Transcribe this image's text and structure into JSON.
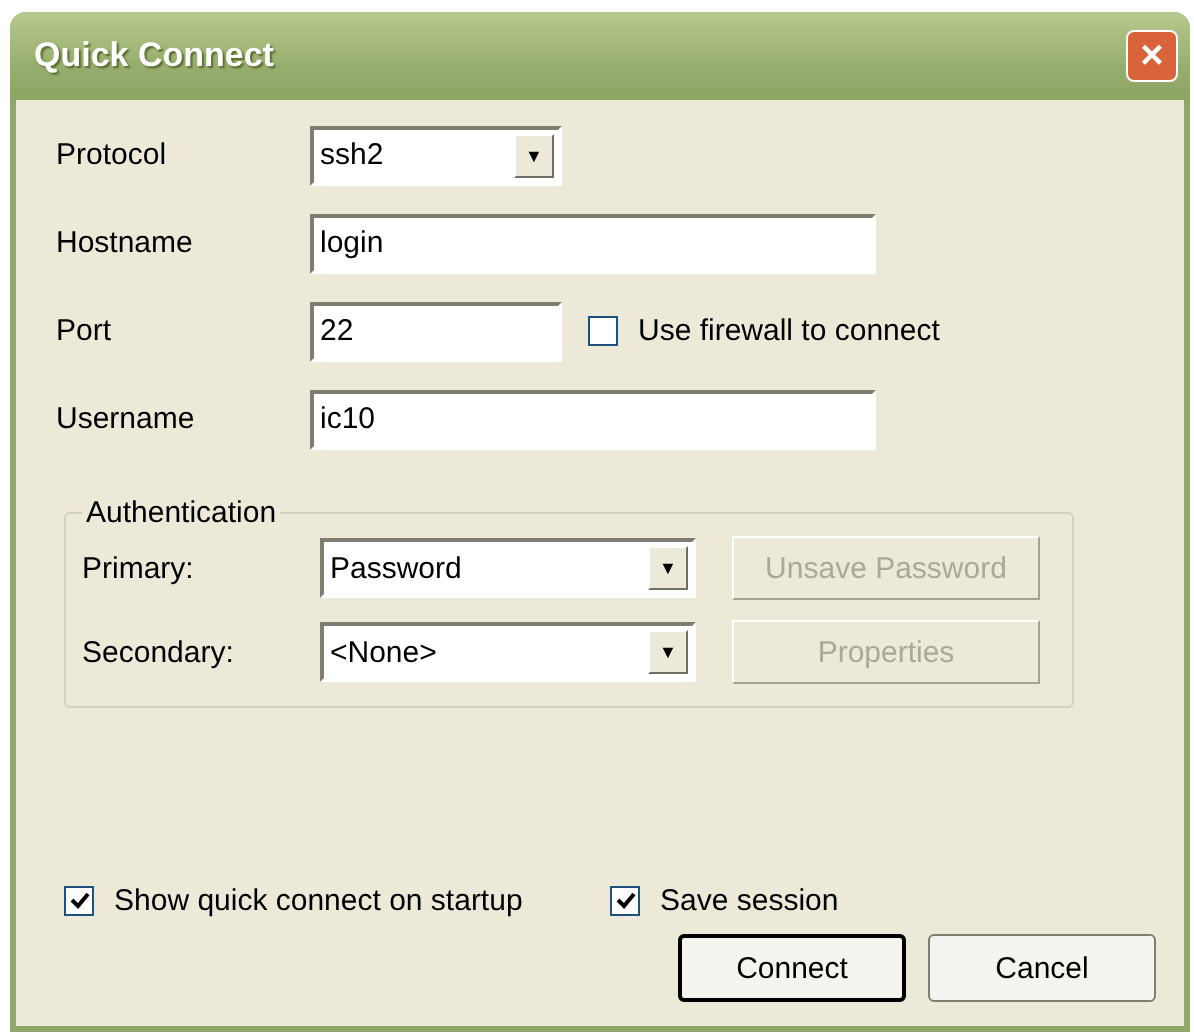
{
  "window": {
    "title": "Quick Connect",
    "close": "×"
  },
  "fields": [
    {
      "kind": "select",
      "label": "Protocol",
      "value": "ssh2",
      "arrow": "▼"
    },
    {
      "kind": "input",
      "label": "Hostname",
      "value": "login"
    },
    {
      "kind": "input",
      "label": "Port",
      "value": "22",
      "checkbox": {
        "label": "Use firewall to connect",
        "checked": false
      }
    },
    {
      "kind": "input",
      "label": "Username",
      "value": "ic10"
    }
  ],
  "authentication": {
    "title": "Authentication",
    "rows": [
      {
        "label": "Primary:",
        "value": "Password",
        "arrow": "▼",
        "button": {
          "label": "Unsave Password",
          "disabled": true
        }
      },
      {
        "label": "Secondary:",
        "value": "<None>",
        "arrow": "▼",
        "button": {
          "label": "Properties",
          "disabled": true
        }
      }
    ]
  },
  "options": [
    {
      "label": "Show quick connect on startup",
      "checked": true
    },
    {
      "label": "Save session",
      "checked": true
    }
  ],
  "buttons": [
    {
      "label": "Connect",
      "default": true
    },
    {
      "label": "Cancel",
      "default": false
    }
  ]
}
